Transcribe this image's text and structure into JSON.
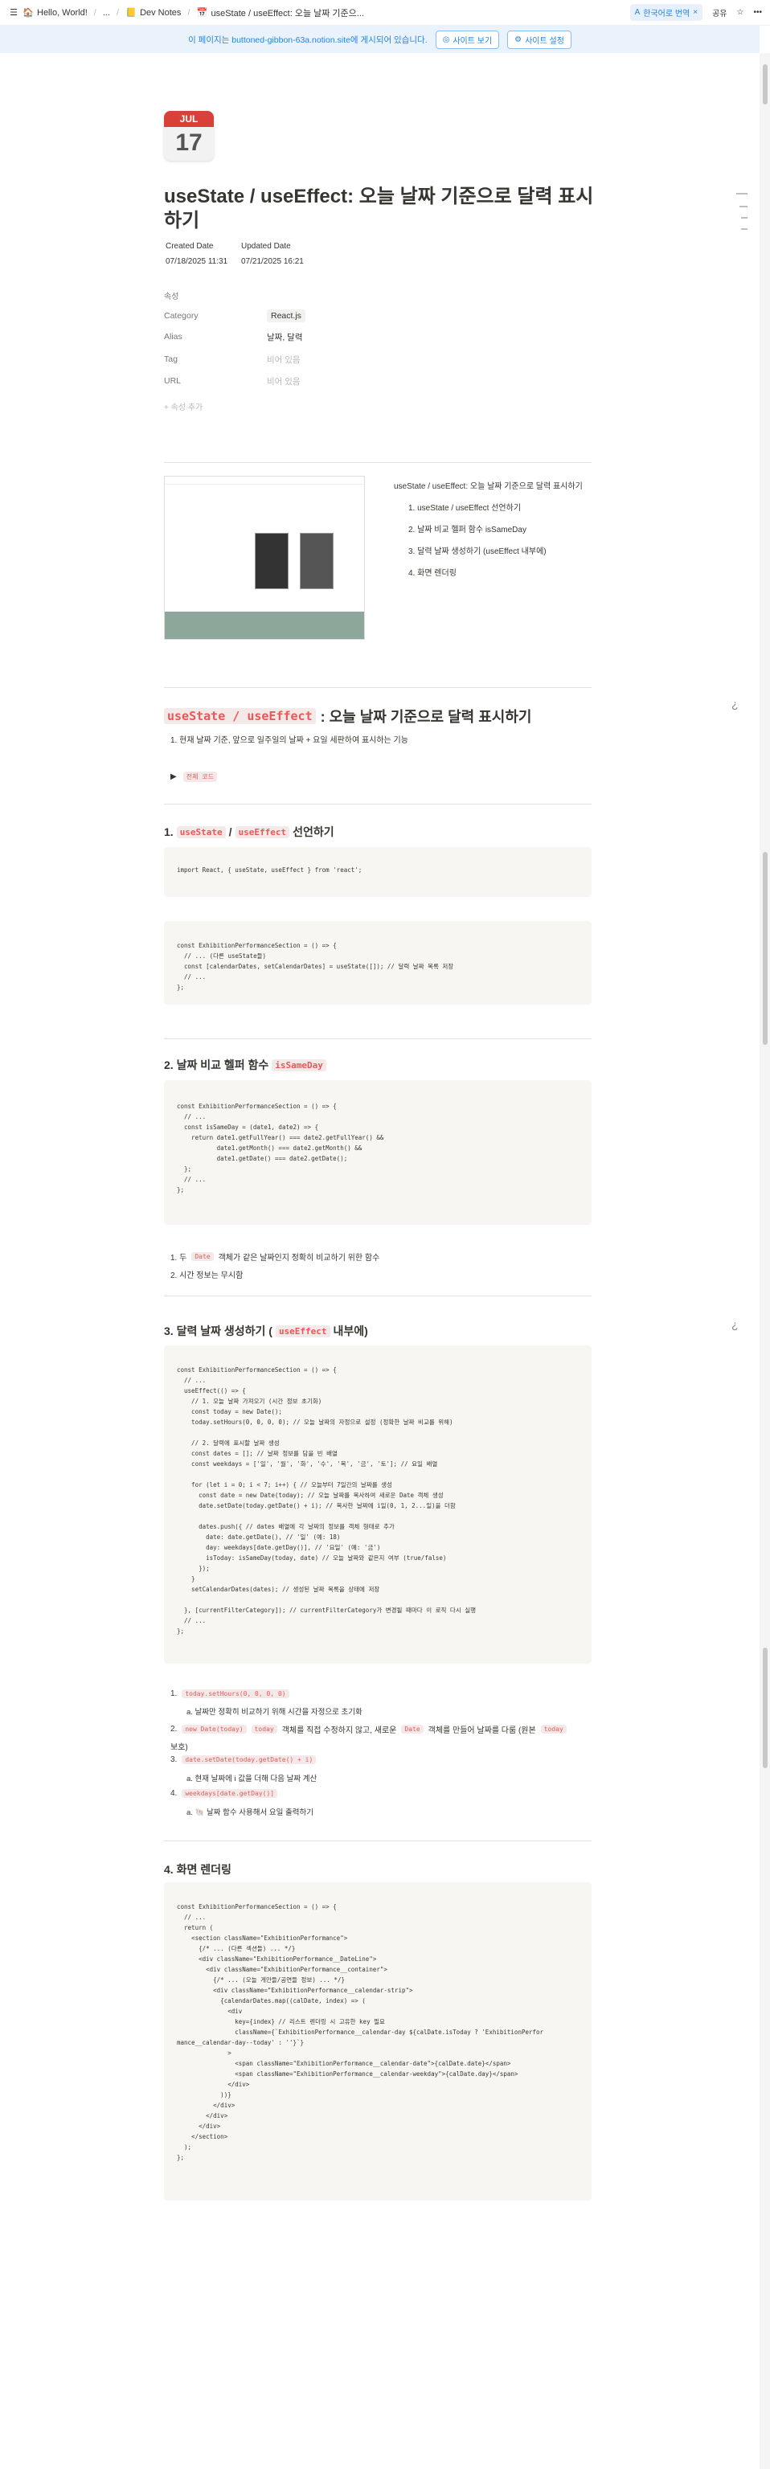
{
  "topbar": {
    "breadcrumbs": [
      {
        "icon": "🏠",
        "label": "Hello, World!"
      },
      {
        "icon": "",
        "label": "..."
      },
      {
        "icon": "📒",
        "label": "Dev Notes"
      },
      {
        "icon": "📅",
        "label": "useState / useEffect: 오늘 날짜 기준으..."
      }
    ],
    "translate_label": "한국어로 번역",
    "share_label": "공유"
  },
  "banner": {
    "text": "이 페이지는 buttoned-gibbon-63a.notion.site에 게시되어 있습니다.",
    "view_site": "사이트 보기",
    "site_settings": "사이트 설정"
  },
  "page": {
    "icon_month": "JUL",
    "icon_day": "17",
    "title": "useState / useEffect: 오늘 날짜 기준으로 달력 표시하기",
    "created_label": "Created Date",
    "created_value": "07/18/2025 11:31",
    "updated_label": "Updated Date",
    "updated_value": "07/21/2025 16:21",
    "props_heading": "속성",
    "props": [
      {
        "key": "Category",
        "value": "React.js",
        "tag": true
      },
      {
        "key": "Alias",
        "value": "날짜, 달력",
        "tag": false
      },
      {
        "key": "Tag",
        "value": "비어 있음",
        "empty": true
      },
      {
        "key": "URL",
        "value": "비어 있음",
        "empty": true
      }
    ],
    "add_prop": "+ 속성 추가"
  },
  "outline": [
    "useState / useEffect: 오늘 날짜 기준으로 달력 표시하기",
    "1. useState / useEffect 선언하기",
    "2. 날짜 비교 헬퍼 함수 isSameDay",
    "3. 달력 날짜 생성하기 (useEffect 내부에)",
    "4. 화면 렌더링"
  ],
  "section_main": {
    "code1": "useState / useEffect",
    "rest": ": 오늘 날짜 기준으로 달력 표시하기",
    "item1": "1.  현재 날짜 기준, 앞으로 일주일의 날짜 + 요일 세판하여 표시하는 기능",
    "toggle_label": "전체 코드"
  },
  "sec1": {
    "num": "1.",
    "c1": "useState",
    "slash": "/",
    "c2": "useEffect",
    "rest": "선언하기"
  },
  "code_a": "import React, { useState, useEffect } from 'react';",
  "code_b": "const ExhibitionPerformanceSection = () => {\n  // ... (다른 useState들)\n  const [calendarDates, setCalendarDates] = useState([]); // 달력 날짜 목록 저장\n  // ...\n};",
  "sec2": {
    "title": "2. 날짜 비교 헬퍼 함수",
    "code": "isSameDay"
  },
  "code_c": "const ExhibitionPerformanceSection = () => {\n  // ...\n  const isSameDay = (date1, date2) => {\n    return date1.getFullYear() === date2.getFullYear() &&\n           date1.getMonth() === date2.getMonth() &&\n           date1.getDate() === date2.getDate();\n  };\n  // ...\n};",
  "sec2_list": [
    {
      "pre": "1.  두",
      "code": "Date",
      "post": "객체가 같은 날짜인지 정확히 비교하기 위한 함수"
    },
    {
      "pre": "2.  시간 정보는 무시함",
      "code": "",
      "post": ""
    }
  ],
  "sec3": {
    "pre": "3. 달력 날짜 생성하기 (",
    "code": "useEffect",
    "post": "내부에)"
  },
  "code_d": "const ExhibitionPerformanceSection = () => {\n  // ...\n  useEffect(() => {\n    // 1. 오늘 날짜 가져오기 (시간 정보 초기화)\n    const today = new Date();\n    today.setHours(0, 0, 0, 0); // 오늘 날짜의 자정으로 설정 (정확한 날짜 비교를 위해)\n\n    // 2. 달력에 표시할 날짜 생성\n    const dates = []; // 날짜 정보를 담을 빈 배열\n    const weekdays = ['일', '월', '화', '수', '목', '금', '토']; // 요일 배열\n\n    for (let i = 0; i < 7; i++) { // 오늘부터 7일간의 날짜를 생성\n      const date = new Date(today); // 오늘 날짜를 복사하여 새로운 Date 객체 생성\n      date.setDate(today.getDate() + i); // 복사한 날짜에 i일(0, 1, 2...일)을 더함\n\n      dates.push({ // dates 배열에 각 날짜의 정보를 객체 형태로 추가\n        date: date.getDate(), // '일' (예: 18)\n        day: weekdays[date.getDay()], // '요일' (예: '금')\n        isToday: isSameDay(today, date) // 오늘 날짜와 같은지 여부 (true/false)\n      });\n    }\n    setCalendarDates(dates); // 생성된 날짜 목록을 상태에 저장\n\n  }, [currentFilterCategory]); // currentFilterCategory가 변경될 때마다 이 로직 다시 실행\n  // ...\n};",
  "sec3_list": [
    {
      "code": "today.setHours(0, 0, 0, 0)",
      "sub": "a.  날짜만 정확히 비교하기 위해 시간을 자정으로 초기화"
    },
    {
      "code": "new Date(today)",
      "mid": "today",
      "mid2": "Date",
      "text": "객체를 직접 수정하지 않고, 새로운",
      "text2": "객체를 만들어 날짜를 다룸 (원본",
      "text3": "보호)"
    },
    {
      "code": "date.setDate(today.getDate() + i)",
      "sub": "a.  현재 날짜에 i 값을 더해 다음 날짜 계산"
    },
    {
      "code": "weekdays[date.getDay()]",
      "sub": "a.  🐚 날짜 함수 사용해서 요일 출력하기"
    }
  ],
  "sec4": {
    "title": "4. 화면 렌더링"
  },
  "code_e": "const ExhibitionPerformanceSection = () => {\n  // ...\n  return (\n    <section className=\"ExhibitionPerformance\">\n      {/* ... (다른 섹션들) ... */}\n      <div className=\"ExhibitionPerformance__DateLine\">\n        <div className=\"ExhibitionPerformance__container\">\n          {/* ... (오늘 게안들/공연들 정보) ... */}\n          <div className=\"ExhibitionPerformance__calendar-strip\">\n            {calendarDates.map((calDate, index) => (\n              <div\n                key={index} // 리스트 렌더링 시 고유한 key 필요\n                className={`ExhibitionPerformance__calendar-day ${calDate.isToday ? 'ExhibitionPerfor\nmance__calendar-day--today' : ''}`}\n              >\n                <span className=\"ExhibitionPerformance__calendar-date\">{calDate.date}</span>\n                <span className=\"ExhibitionPerformance__calendar-weekday\">{calDate.day}</span>\n              </div>\n            ))}\n          </div>\n        </div>\n      </div>\n    </section>\n  );\n};"
}
